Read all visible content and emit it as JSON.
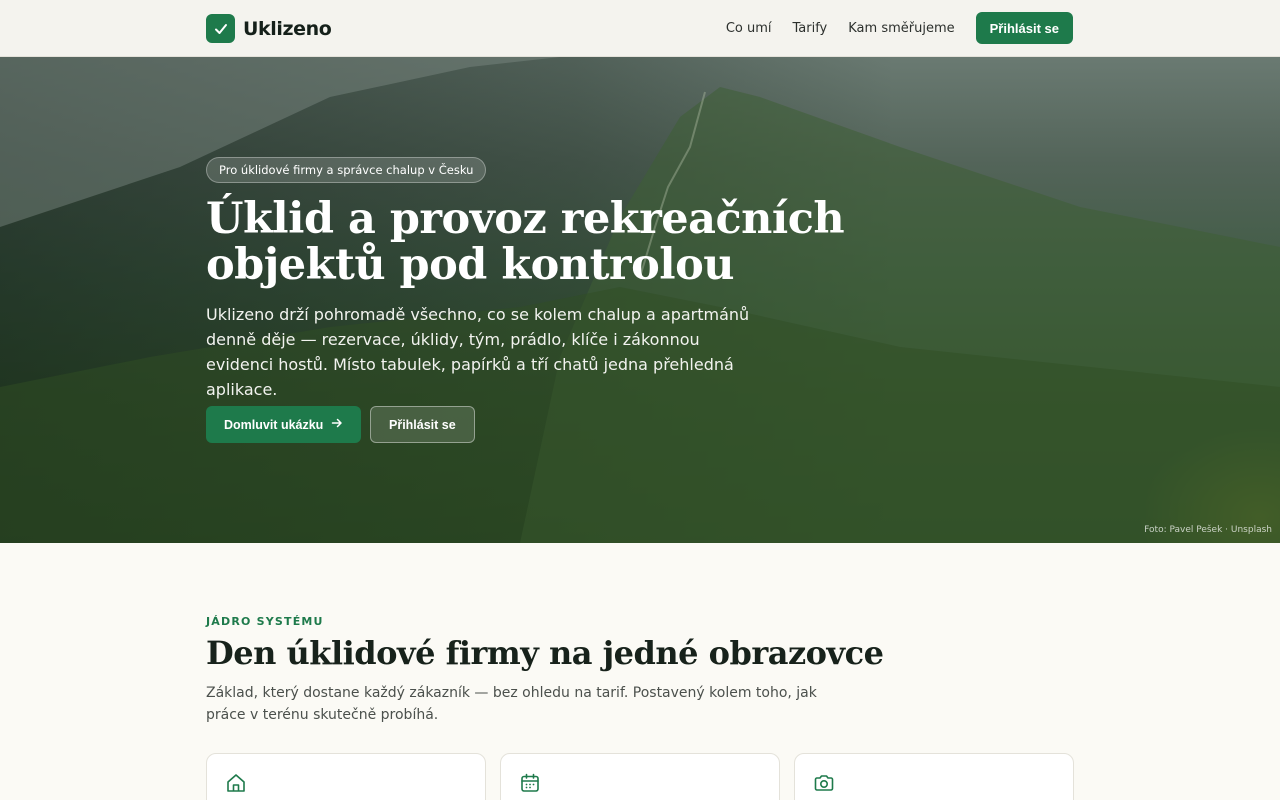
{
  "header": {
    "logo_text": "Uklizeno",
    "nav": [
      {
        "label": "Co umí"
      },
      {
        "label": "Tarify"
      },
      {
        "label": "Kam směřujeme"
      }
    ],
    "login_button": "Přihlásit se"
  },
  "hero": {
    "badge": "Pro úklidové firmy a správce chalup v Česku",
    "title": "Úklid a provoz rekreačních objektů pod kontrolou",
    "text": "Uklizeno drží pohromadě všechno, co se kolem chalup a apartmánů denně děje — rezervace, úklidy, tým, prádlo, klíče i zákonnou evidenci hostů. Místo tabulek, papírků a tří chatů jedna přehledná aplikace.",
    "primary_button": "Domluvit ukázku",
    "secondary_button": "Přihlásit se",
    "photo_credit": "Foto: Pavel Pešek · Unsplash"
  },
  "section": {
    "eyebrow": "JÁDRO SYSTÉMU",
    "title": "Den úklidové firmy na jedné obrazovce",
    "text": "Základ, který dostane každý zákazník — bez ohledu na tarif. Postavený kolem toho, jak práce v terénu skutečně probíhá.",
    "cards": [
      {
        "icon": "home-icon"
      },
      {
        "icon": "calendar-icon"
      },
      {
        "icon": "camera-icon"
      }
    ]
  },
  "colors": {
    "brand": "#1e7a4b",
    "background": "#fbfaf5"
  }
}
